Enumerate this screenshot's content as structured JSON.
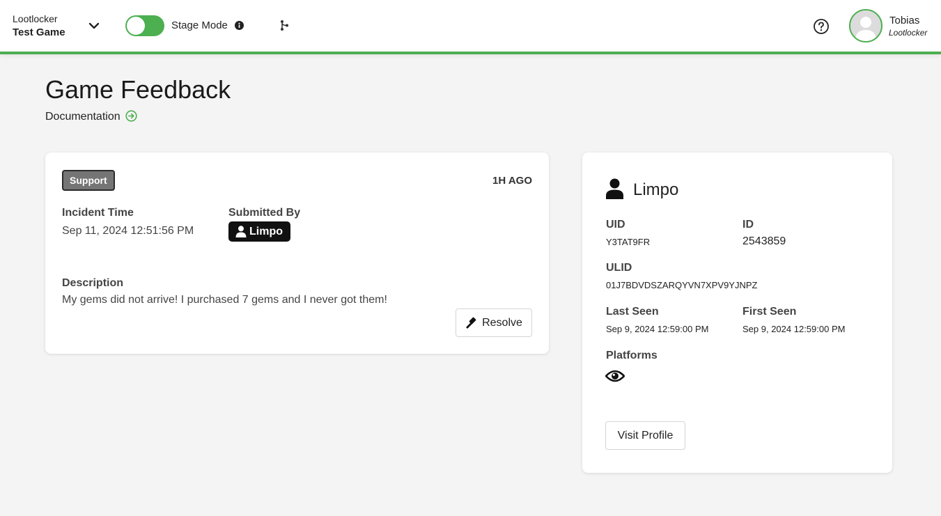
{
  "header": {
    "org_name": "Lootlocker",
    "game_name": "Test Game",
    "stage_mode_label": "Stage Mode",
    "stage_mode_on": true,
    "user_name": "Tobias",
    "user_org": "Lootlocker"
  },
  "page": {
    "title": "Game Feedback",
    "documentation_link": "Documentation"
  },
  "feedback": {
    "category": "Support",
    "time_ago": "1H AGO",
    "incident_time_label": "Incident Time",
    "incident_time": "Sep 11, 2024 12:51:56 PM",
    "submitted_by_label": "Submitted By",
    "submitted_by": "Limpo",
    "description_label": "Description",
    "description": "My gems did not arrive! I purchased 7 gems and I never got them!",
    "resolve_label": "Resolve"
  },
  "player": {
    "name": "Limpo",
    "uid_label": "UID",
    "uid": "Y3TAT9FR",
    "id_label": "ID",
    "id": "2543859",
    "ulid_label": "ULID",
    "ulid": "01J7BDVDSZARQYVN7XPV9YJNPZ",
    "last_seen_label": "Last Seen",
    "last_seen": "Sep 9, 2024 12:59:00 PM",
    "first_seen_label": "First Seen",
    "first_seen": "Sep 9, 2024 12:59:00 PM",
    "platforms_label": "Platforms",
    "platform_icons": [
      "eye-icon"
    ],
    "visit_profile_label": "Visit Profile"
  },
  "colors": {
    "accent": "#4caf50",
    "badge_bg": "#757575",
    "pill_bg": "#111111"
  }
}
